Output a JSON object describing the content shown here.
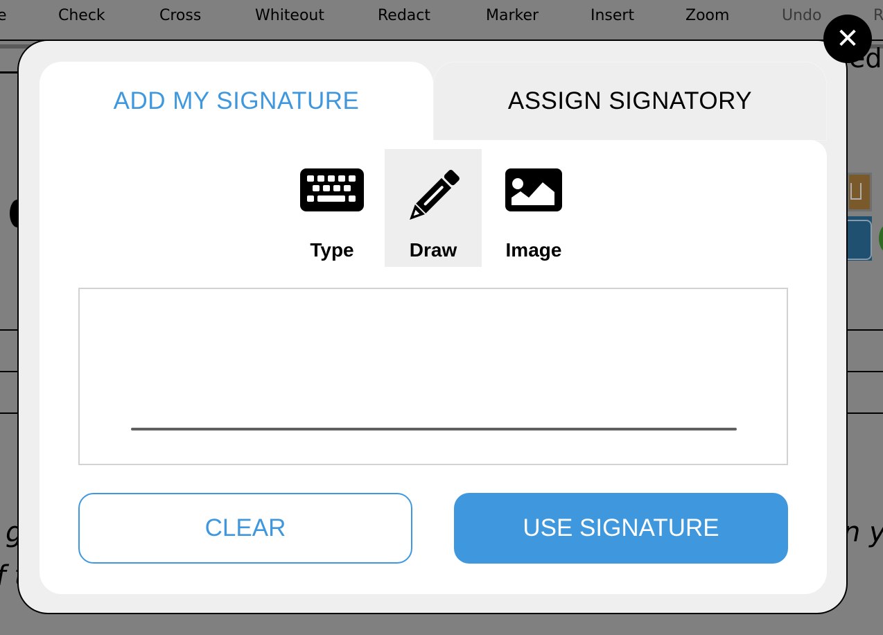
{
  "background": {
    "toolbar": [
      {
        "label": "e",
        "disabled": false
      },
      {
        "label": "Check",
        "disabled": false
      },
      {
        "label": "Cross",
        "disabled": false
      },
      {
        "label": "Whiteout",
        "disabled": false
      },
      {
        "label": "Redact",
        "disabled": false
      },
      {
        "label": "Marker",
        "disabled": false
      },
      {
        "label": "Insert",
        "disabled": false
      },
      {
        "label": "Zoom",
        "disabled": false
      },
      {
        "label": "Undo",
        "disabled": true
      },
      {
        "label": "R",
        "disabled": true
      }
    ],
    "heading_fragment": "ed",
    "text_fragment_left_1": "g",
    "text_fragment_left_2": "f t",
    "text_fragment_right": "n y"
  },
  "modal": {
    "close_icon": "✕",
    "tabs": [
      {
        "label": "ADD MY SIGNATURE",
        "active": true
      },
      {
        "label": "ASSIGN SIGNATORY",
        "active": false
      }
    ],
    "modes": [
      {
        "label": "Type",
        "icon": "keyboard-icon",
        "selected": false
      },
      {
        "label": "Draw",
        "icon": "pencil-icon",
        "selected": true
      },
      {
        "label": "Image",
        "icon": "image-icon",
        "selected": false
      }
    ],
    "buttons": {
      "clear": "CLEAR",
      "use": "USE SIGNATURE"
    },
    "colors": {
      "accent": "#3f98de"
    }
  }
}
